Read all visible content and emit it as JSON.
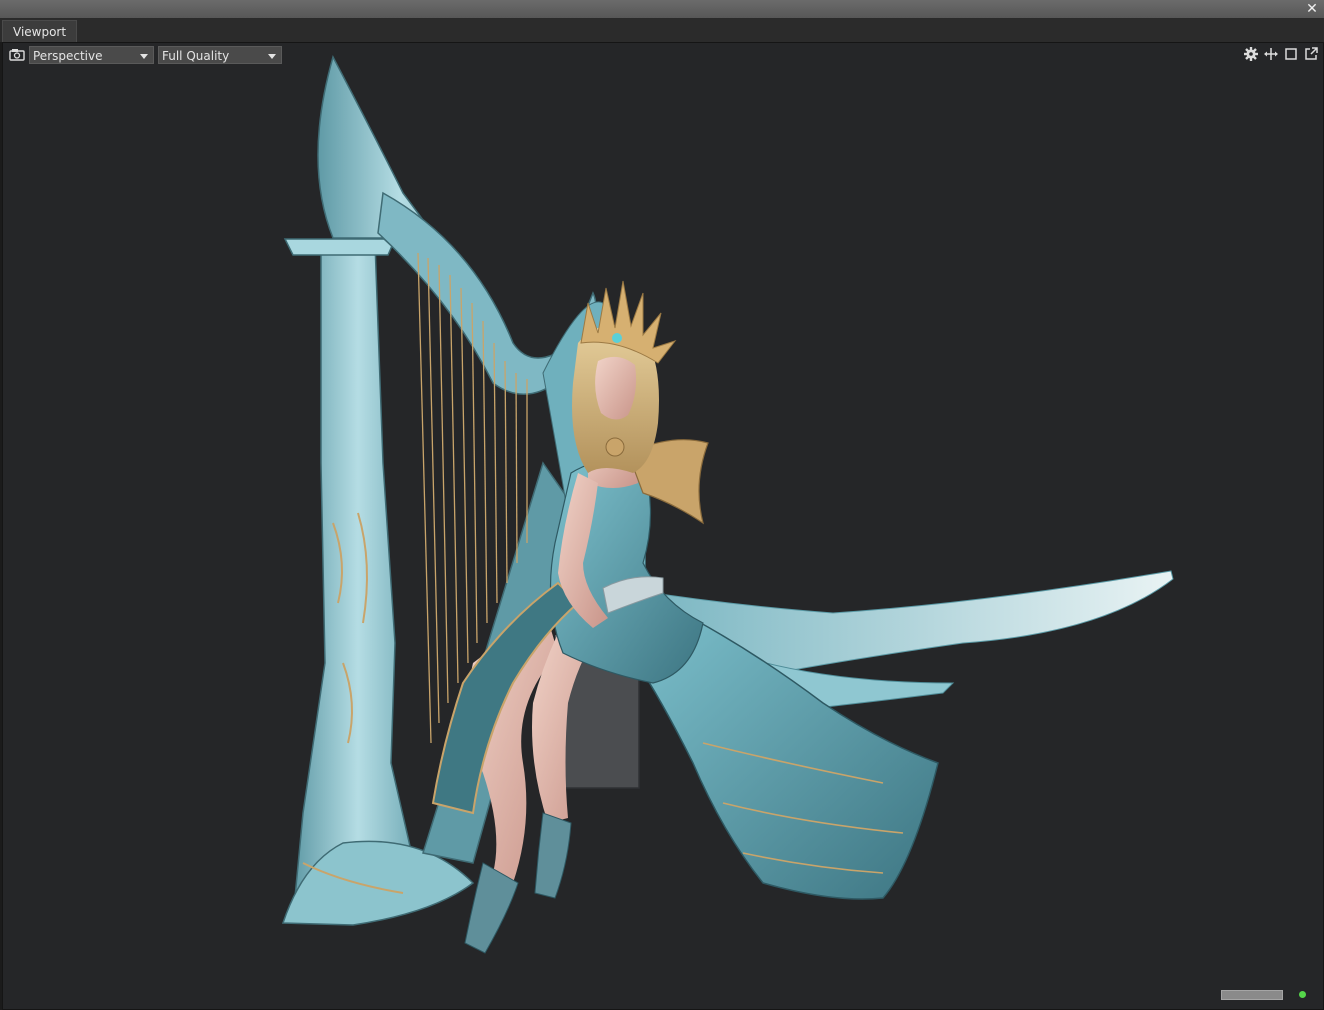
{
  "window": {
    "close_icon": "close-icon"
  },
  "tabs": [
    {
      "label": "Viewport",
      "active": true
    }
  ],
  "toolbar": {
    "camera_icon": "camera-icon",
    "view_mode": {
      "selected": "Perspective"
    },
    "quality": {
      "selected": "Full Quality"
    },
    "icons": [
      "settings-icon",
      "move-icon",
      "maximize-icon",
      "popout-icon"
    ]
  },
  "scene": {
    "description_icon": "3d-model-render",
    "background_color": "#252628",
    "accent_colors": {
      "teal": "#7fb8c4",
      "gold": "#c9a46a",
      "skin": "#e8c2b6"
    }
  },
  "status": {
    "indicator_color": "#55d64a"
  }
}
